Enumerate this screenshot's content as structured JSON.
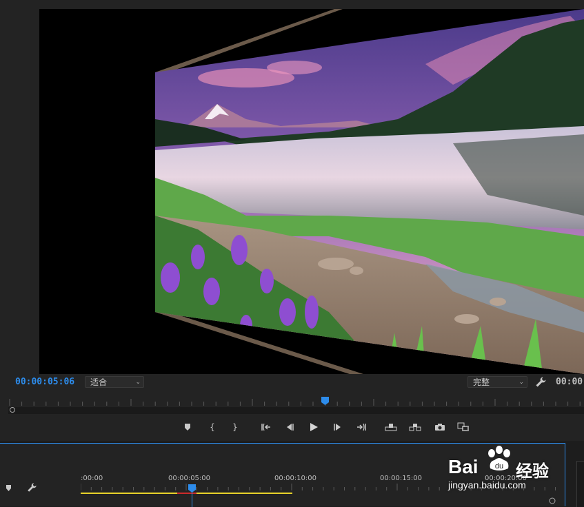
{
  "monitor": {
    "current_timecode": "00:00:05:06",
    "duration_timecode": "00:00",
    "zoom_select": "适合",
    "quality_select": "完整"
  },
  "transport": {
    "buttons": [
      {
        "name": "add-marker-button",
        "icon": "marker-icon"
      },
      {
        "name": "mark-in-button",
        "icon": "mark-in-icon"
      },
      {
        "name": "mark-out-button",
        "icon": "mark-out-icon"
      },
      {
        "name": "go-to-in-button",
        "icon": "go-to-in-icon"
      },
      {
        "name": "step-back-button",
        "icon": "step-back-icon"
      },
      {
        "name": "play-button",
        "icon": "play-icon"
      },
      {
        "name": "step-forward-button",
        "icon": "step-forward-icon"
      },
      {
        "name": "go-to-out-button",
        "icon": "go-to-out-icon"
      },
      {
        "name": "lift-button",
        "icon": "lift-icon"
      },
      {
        "name": "extract-button",
        "icon": "extract-icon"
      },
      {
        "name": "export-frame-button",
        "icon": "camera-icon"
      },
      {
        "name": "compare-view-button",
        "icon": "compare-icon"
      }
    ]
  },
  "timeline": {
    "ruler_labels": [
      ":00:00",
      "00:00:05:00",
      "00:00:10:00",
      "00:00:15:00",
      "00:00:20:00"
    ],
    "work_area_color": "#e8d22a",
    "render_red_color": "#cc2b2b",
    "playhead_color": "#2d8ceb"
  },
  "watermark": {
    "brand": "Bai",
    "brand_cn": "经验",
    "url": "jingyan.baidu.com"
  },
  "colors": {
    "accent": "#2d8ceb",
    "panel_bg": "#232323",
    "viewer_bg": "#000000"
  }
}
